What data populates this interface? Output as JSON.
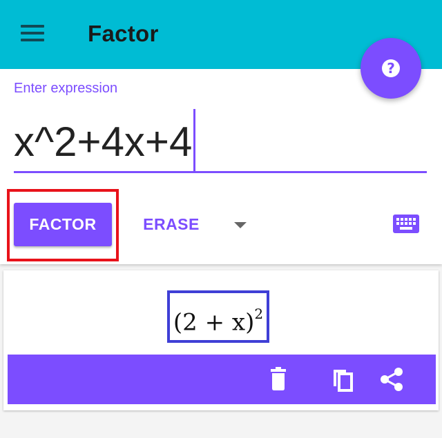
{
  "appbar": {
    "title": "Factor",
    "menu_icon": "hamburger-menu-icon",
    "help_icon": "help-circle-icon",
    "help_glyph": "?",
    "color": "#00bcd4"
  },
  "input": {
    "label": "Enter expression",
    "value": "x^2+4x+4"
  },
  "actions": {
    "factor_label": "FACTOR",
    "erase_label": "ERASE",
    "dropdown_icon": "dropdown-arrow-icon",
    "keyboard_icon": "keyboard-icon"
  },
  "result": {
    "base": "(2 + x)",
    "exponent": "2",
    "delete_icon": "delete-icon",
    "copy_icon": "copy-icon",
    "share_icon": "share-icon"
  },
  "colors": {
    "accent": "#7c4dff",
    "appbar": "#00bcd4",
    "highlight_red": "#e8121a",
    "highlight_blue": "#3f3fd6"
  }
}
